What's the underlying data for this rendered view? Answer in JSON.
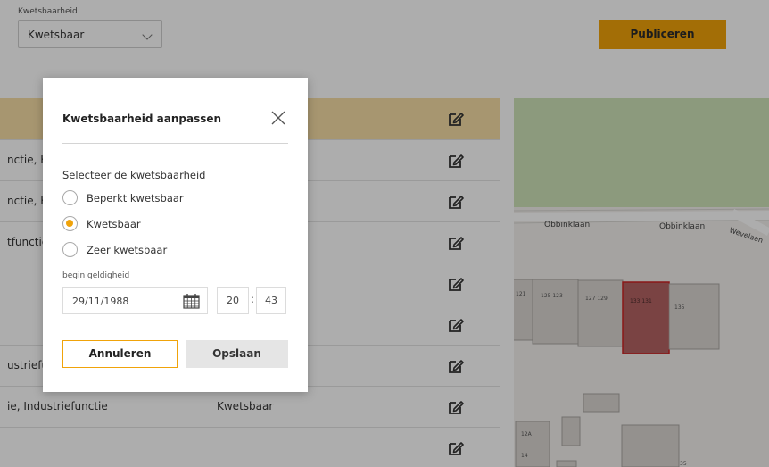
{
  "filter": {
    "label": "Kwetsbaarheid",
    "value": "Kwetsbaar"
  },
  "publish_label": "Publiceren",
  "table": {
    "rows": [
      {
        "col_a": "",
        "col_b": ""
      },
      {
        "col_a": "nctie, K",
        "col_b": ""
      },
      {
        "col_a": "nctie, K",
        "col_b": ""
      },
      {
        "col_a": "tfunctie",
        "col_b": ""
      },
      {
        "col_a": "",
        "col_b": ""
      },
      {
        "col_a": "",
        "col_b": ""
      },
      {
        "col_a": "ustriefu",
        "col_b": ""
      },
      {
        "col_a": "ie, Industriefunctie",
        "col_b": "Kwetsbaar"
      },
      {
        "col_a": "",
        "col_b": ""
      }
    ]
  },
  "map": {
    "street_labels": [
      "Obbinklaan",
      "Obbinklaan",
      "Wevelaan"
    ],
    "house_numbers": [
      "121",
      "125 123",
      "127 129",
      "133 131",
      "135",
      "12A",
      "14",
      "35"
    ],
    "selected_color": "#b46464"
  },
  "modal": {
    "title": "Kwetsbaarheid aanpassen",
    "section_label": "Selecteer de kwetsbaarheid",
    "options": [
      {
        "label": "Beperkt kwetsbaar",
        "checked": false
      },
      {
        "label": "Kwetsbaar",
        "checked": true
      },
      {
        "label": "Zeer kwetsbaar",
        "checked": false
      }
    ],
    "date_label": "begin geldigheid",
    "date_value": "29/11/1988",
    "time_hours": "20",
    "time_separator": ":",
    "time_minutes": "43",
    "cancel_label": "Annuleren",
    "save_label": "Opslaan"
  },
  "colors": {
    "accent": "#f0a30a",
    "highlight_row": "#f6dea5",
    "map_green": "#cfe3b8"
  }
}
